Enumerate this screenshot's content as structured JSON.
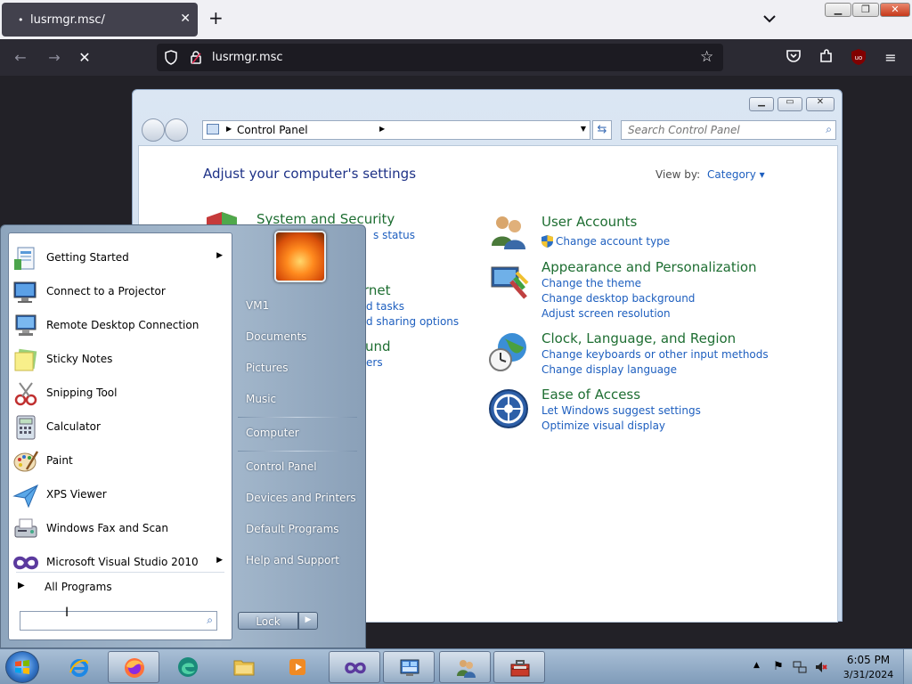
{
  "browser": {
    "tab_title": "lusrmgr.msc/",
    "tab_close": "✕",
    "new_tab": "+",
    "url": "lusrmgr.msc"
  },
  "control_panel": {
    "breadcrumb": "Control Panel",
    "search_placeholder": "Search Control Panel",
    "heading": "Adjust your computer's settings",
    "view_by_label": "View by:",
    "view_by_value": "Category",
    "categories_left": [
      {
        "title": "System and Security",
        "links": [
          "s status"
        ]
      },
      {
        "title": "rnet",
        "links": [
          "d tasks",
          "d sharing options"
        ]
      },
      {
        "title": "und",
        "links": [
          "ers"
        ]
      }
    ],
    "categories_right": [
      {
        "title": "User Accounts",
        "links": [
          "Change account type"
        ]
      },
      {
        "title": "Appearance and Personalization",
        "links": [
          "Change the theme",
          "Change desktop background",
          "Adjust screen resolution"
        ]
      },
      {
        "title": "Clock, Language, and Region",
        "links": [
          "Change keyboards or other input methods",
          "Change display language"
        ]
      },
      {
        "title": "Ease of Access",
        "links": [
          "Let Windows suggest settings",
          "Optimize visual display"
        ]
      }
    ]
  },
  "start_menu": {
    "programs": [
      {
        "label": "Getting Started",
        "has_submenu": true,
        "icon": "getting-started-icon"
      },
      {
        "label": "Connect to a Projector",
        "has_submenu": false,
        "icon": "projector-icon"
      },
      {
        "label": "Remote Desktop Connection",
        "has_submenu": false,
        "icon": "remote-desktop-icon"
      },
      {
        "label": "Sticky Notes",
        "has_submenu": false,
        "icon": "sticky-notes-icon"
      },
      {
        "label": "Snipping Tool",
        "has_submenu": false,
        "icon": "snipping-tool-icon"
      },
      {
        "label": "Calculator",
        "has_submenu": false,
        "icon": "calculator-icon"
      },
      {
        "label": "Paint",
        "has_submenu": false,
        "icon": "paint-icon"
      },
      {
        "label": "XPS Viewer",
        "has_submenu": false,
        "icon": "xps-viewer-icon"
      },
      {
        "label": "Windows Fax and Scan",
        "has_submenu": false,
        "icon": "fax-scan-icon"
      },
      {
        "label": "Microsoft Visual Studio 2010",
        "has_submenu": true,
        "icon": "visual-studio-icon"
      }
    ],
    "all_programs": "All Programs",
    "right_items": [
      "VM1",
      "Documents",
      "Pictures",
      "Music",
      "Computer",
      "Control Panel",
      "Devices and Printers",
      "Default Programs",
      "Help and Support"
    ],
    "lock_label": "Lock",
    "submenu_arrow": "▶"
  },
  "taskbar": {
    "time": "6:05 PM",
    "date": "3/31/2024",
    "pinned": [
      "ie-icon",
      "firefox-icon",
      "edge-icon",
      "explorer-icon",
      "media-player-icon",
      "visual-studio-icon",
      "server-manager-icon",
      "users-icon",
      "toolbox-icon"
    ]
  },
  "colors": {
    "link": "#1e5fbf",
    "category_title": "#1e6e32",
    "heading": "#1e3287",
    "firefox_dark": "#2b2a33"
  }
}
